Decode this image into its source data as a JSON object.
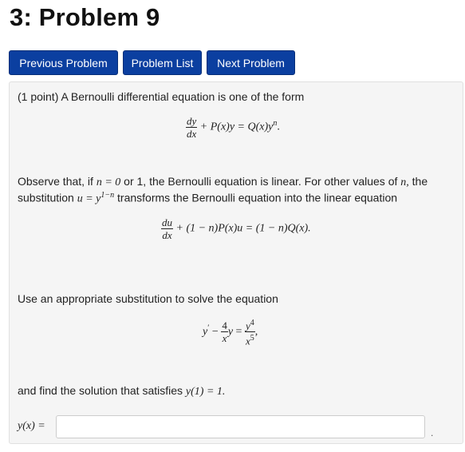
{
  "header": {
    "title": "3: Problem 9"
  },
  "nav": {
    "previous": "Previous Problem",
    "list": "Problem List",
    "next": "Next Problem"
  },
  "problem": {
    "intro": "(1 point) A Bernoulli differential equation is one of the form",
    "eq1": {
      "dy": "dy",
      "dx": "dx",
      "rest": "+ P(x)y = Q(x)y",
      "exp": "n",
      "end": "."
    },
    "observe_line1_a": "Observe that, if",
    "observe_line1_math": "n = 0",
    "observe_line1_b": "or 1, the Bernoulli equation is linear. For other values of",
    "observe_line1_n": "n,",
    "observe_line1_c": "the",
    "observe_line2_a": "substitution",
    "observe_line2_math": "u = y",
    "observe_line2_exp": "1−n",
    "observe_line2_b": "transforms the Bernoulli equation into the linear equation",
    "eq2": {
      "du": "du",
      "dx": "dx",
      "rest": "+ (1 − n)P(x)u = (1 − n)Q(x)."
    },
    "use": "Use an appropriate substitution to solve the equation",
    "eq3": {
      "yprime": "y",
      "prime": "′",
      "minus": "−",
      "num4": "4",
      "denx": "x",
      "y": "y",
      "eqsign": "=",
      "y4": "y",
      "exp4": "4",
      "x5": "x",
      "exp5": "5",
      "comma": ","
    },
    "find_a": "and find the solution that satisfies",
    "find_math": "y(1) = 1.",
    "answer_label": "y(x) =",
    "answer_value": "",
    "answer_end": "."
  }
}
